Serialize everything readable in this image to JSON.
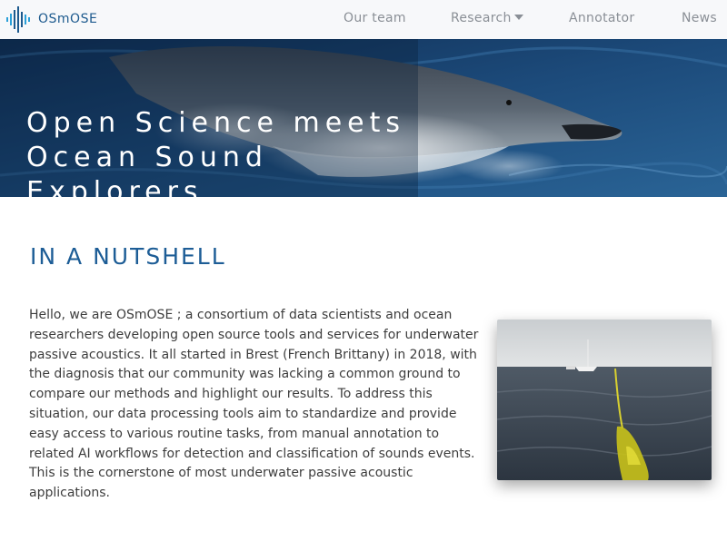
{
  "brand": {
    "name": "OSmOSE",
    "accent": "#1d5a8e",
    "logo_icon": "waveform-logo-icon"
  },
  "nav": {
    "items": [
      {
        "label": "Our team"
      },
      {
        "label": "Research",
        "dropdown": true
      },
      {
        "label": "Annotator"
      },
      {
        "label": "News"
      }
    ]
  },
  "hero": {
    "title_lines": [
      "Open Science meets",
      "Ocean Sound",
      "Explorers"
    ],
    "image": "dolphin-underwater-image"
  },
  "section": {
    "title": "IN A NUTSHELL",
    "body": "Hello, we are OSmOSE ; a consortium of data scientists and ocean researchers developing open source tools and services for underwater passive acoustics. It all started in Brest (French Brittany) in 2018, with the diagnosis that our community was lacking a common ground to compare our methods and highlight our results. To address this situation, our data processing tools aim to standardize and provide easy access to various routine tasks, from manual annotation to related AI workflows for detection and classification of sounds events. This is the cornerstone of most underwater passive acoustic applications.",
    "photo": "sea-glider-photo"
  },
  "colors": {
    "navbar_bg": "#f7f8fa",
    "nav_text": "#8a8f96",
    "heading": "#1d5d96",
    "hero_bg": "#163a63"
  }
}
